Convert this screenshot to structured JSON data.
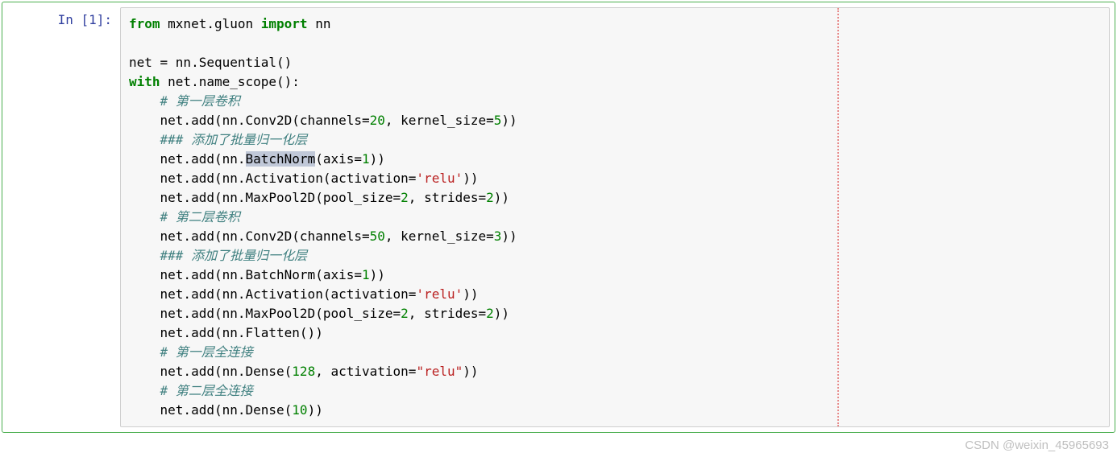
{
  "prompt": "In [1]:",
  "code": {
    "line1_kw1": "from",
    "line1_mod": " mxnet.gluon ",
    "line1_kw2": "import",
    "line1_imp": " nn",
    "line3": "net = nn.Sequential()",
    "line4_kw": "with",
    "line4_rest": " net.name_scope():",
    "line5_comment": "    # 第一层卷积",
    "line6_a": "    net.add(nn.Conv2D(channels=",
    "line6_n1": "20",
    "line6_b": ", kernel_size=",
    "line6_n2": "5",
    "line6_c": "))",
    "line7_comment": "    ### 添加了批量归一化层",
    "line8_a": "    net.add(nn.",
    "line8_sel": "BatchNorm",
    "line8_b": "(axis=",
    "line8_n": "1",
    "line8_c": "))",
    "line9_a": "    net.add(nn.Activation(activation=",
    "line9_s": "'relu'",
    "line9_b": "))",
    "line10_a": "    net.add(nn.MaxPool2D(pool_size=",
    "line10_n1": "2",
    "line10_b": ", strides=",
    "line10_n2": "2",
    "line10_c": "))",
    "line11_comment": "    # 第二层卷积",
    "line12_a": "    net.add(nn.Conv2D(channels=",
    "line12_n1": "50",
    "line12_b": ", kernel_size=",
    "line12_n2": "3",
    "line12_c": "))",
    "line13_comment": "    ### 添加了批量归一化层",
    "line14_a": "    net.add(nn.BatchNorm(axis=",
    "line14_n": "1",
    "line14_b": "))",
    "line15_a": "    net.add(nn.Activation(activation=",
    "line15_s": "'relu'",
    "line15_b": "))",
    "line16_a": "    net.add(nn.MaxPool2D(pool_size=",
    "line16_n1": "2",
    "line16_b": ", strides=",
    "line16_n2": "2",
    "line16_c": "))",
    "line17": "    net.add(nn.Flatten())",
    "line18_comment": "    # 第一层全连接",
    "line19_a": "    net.add(nn.Dense(",
    "line19_n": "128",
    "line19_b": ", activation=",
    "line19_s": "\"relu\"",
    "line19_c": "))",
    "line20_comment": "    # 第二层全连接",
    "line21_a": "    net.add(nn.Dense(",
    "line21_n": "10",
    "line21_b": "))"
  },
  "watermark": "CSDN @weixin_45965693"
}
